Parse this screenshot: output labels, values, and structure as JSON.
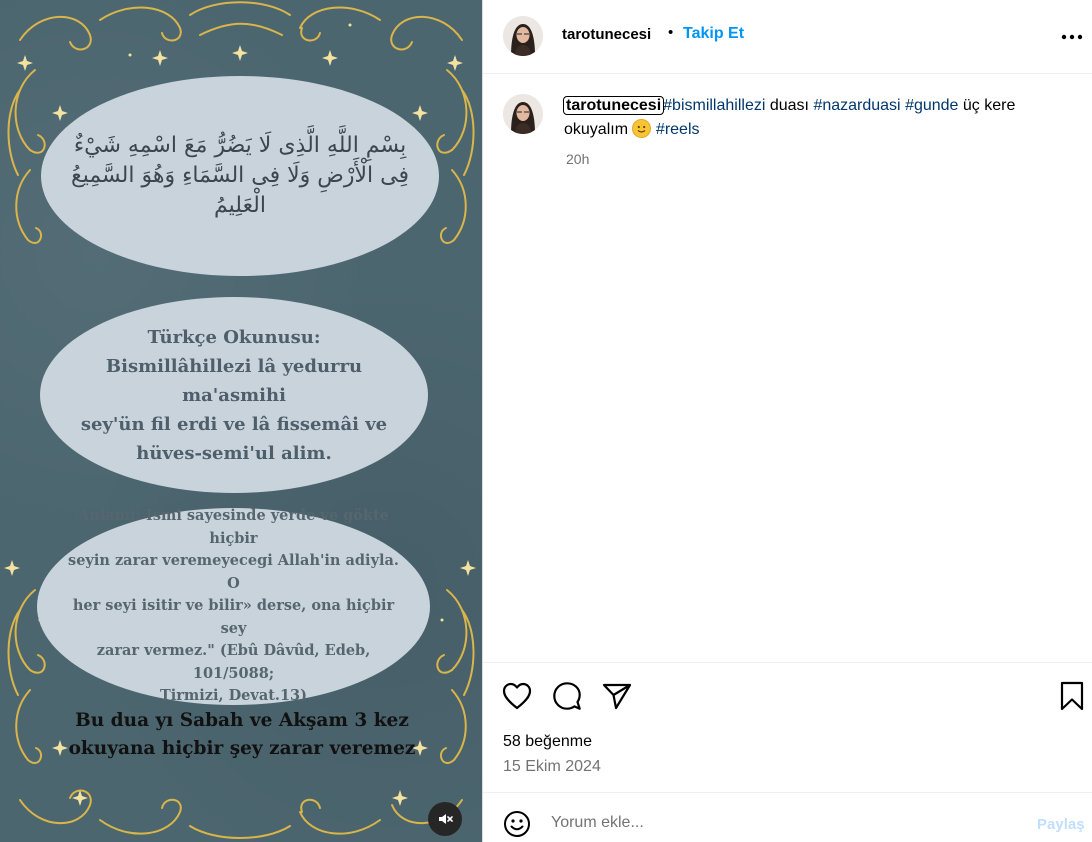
{
  "post": {
    "username": "tarotunecesi",
    "separator": "•",
    "follow_label": "Takip Et",
    "more_icon": "more-horizontal-icon"
  },
  "media": {
    "arabic_text": "بِسْمِ اللَّهِ الَّذِى لَا يَضُرُّ مَعَ اسْمِهِ شَيْءٌ فِى الْأَرْضِ وَلَا فِى السَّمَاءِ وَهُوَ السَّمِيعُ الْعَلِيمُ",
    "turkish_reading": "Türkçe Okunusu:\nBismillâhillezi lâ yedurru ma'asmihi\nsey'ün fil erdi ve lâ fissemâi ve\nhüves-semi'ul alim.",
    "meaning": "Anlami: Ismi sayesinde yerde ve gökte hiçbir\nseyin zarar veremeyecegi Allah'in adiyla. O\nher seyi isitir ve bilir» derse, ona hiçbir sey\nzarar vermez.\" (Ebû Dâvûd, Edeb, 101/5088;\nTirmizi, Devat.13)",
    "bottom_note": "Bu dua yı Sabah ve Akşam 3 kez\nokuyana hiçbir şey zarar veremez",
    "mute_icon": "muted-speaker-icon",
    "background_color": "#4c6670",
    "oval_color": "#c9d3dc",
    "ornament_color": "#d9b54a"
  },
  "caption": {
    "username": "tarotunecesi",
    "tag1": "#bismillahillezi",
    "text1": " duası ",
    "tag2": "#nazarduasi",
    "tag3": "#gunde",
    "text2": " üç kere okuyalım ",
    "emoji": "smiling-face-emoji",
    "tag4": "#reels",
    "time_ago": "20h"
  },
  "actions": {
    "like_icon": "heart-icon",
    "comment_icon": "comment-icon",
    "share_icon": "send-icon",
    "save_icon": "bookmark-icon",
    "likes": "58 beğenme",
    "date": "15 Ekim 2024"
  },
  "comment": {
    "emoji_icon": "emoji-icon",
    "placeholder": "Yorum ekle...",
    "share_label": "Paylaş"
  },
  "colors": {
    "link_blue": "#0095f6",
    "hashtag": "#00376b",
    "muted_text": "#737373"
  }
}
